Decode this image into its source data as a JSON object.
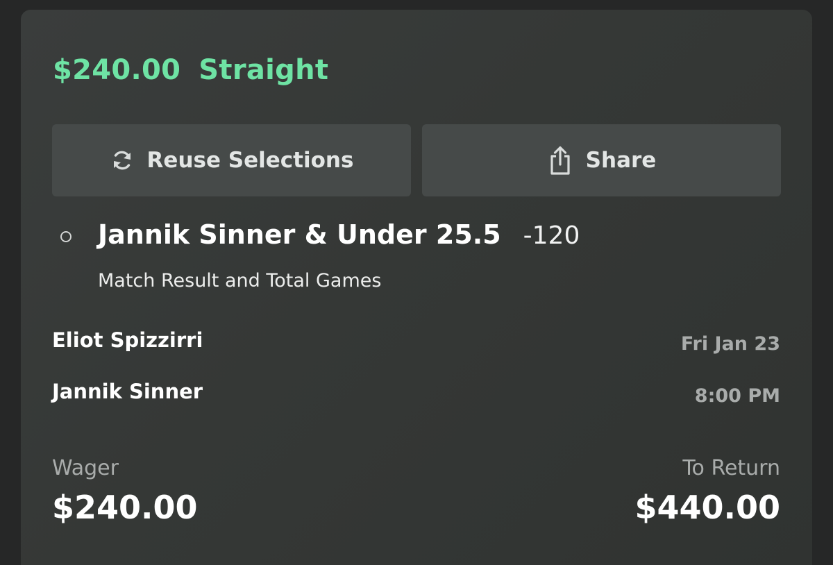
{
  "bet": {
    "stake": "$240.00",
    "type": "Straight"
  },
  "actions": {
    "reuse_label": "Reuse Selections",
    "reuse_icon": "refresh-icon",
    "share_label": "Share",
    "share_icon": "share-icon"
  },
  "selection": {
    "name": "Jannik Sinner & Under 25.5",
    "odds": "-120",
    "market": "Match Result and Total Games"
  },
  "event": {
    "team_1": "Eliot Spizzirri",
    "team_2": "Jannik Sinner",
    "date": "Fri Jan 23",
    "time": "8:00 PM"
  },
  "summary": {
    "wager_label": "Wager",
    "wager_value": "$240.00",
    "return_label": "To Return",
    "return_value": "$440.00"
  },
  "colors": {
    "accent": "#6ee3a4",
    "card_bg": "#363937",
    "button_bg": "#464a49",
    "muted_text": "#a9acab"
  }
}
